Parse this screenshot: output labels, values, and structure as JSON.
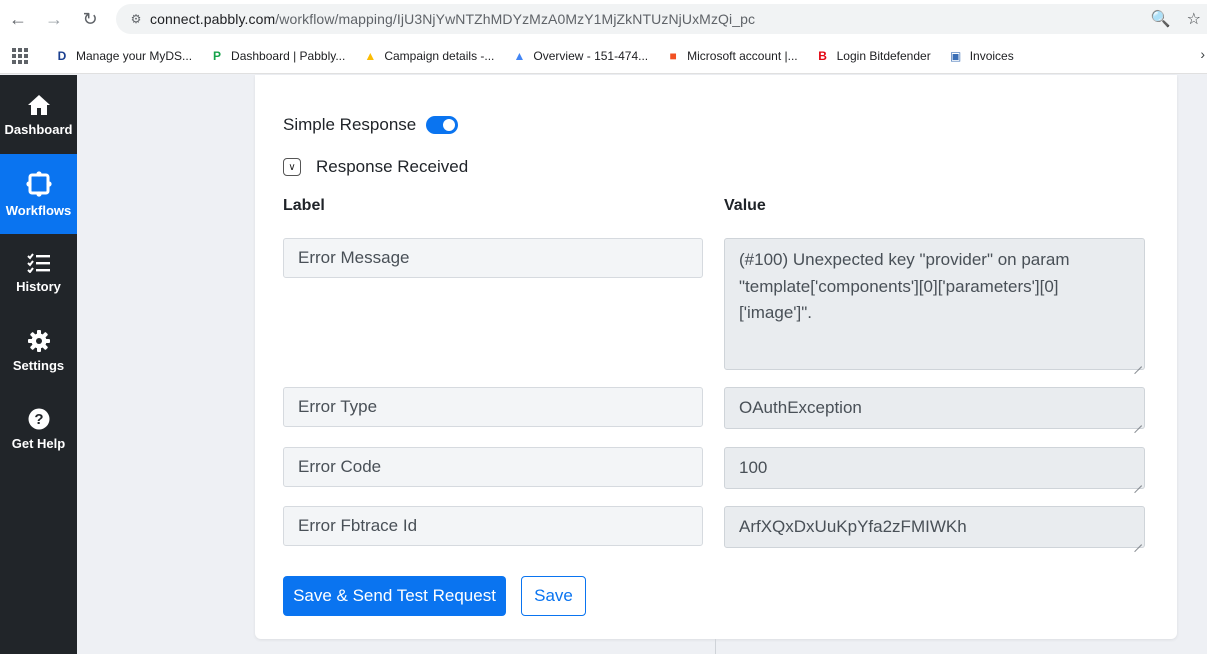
{
  "browser": {
    "url_host": "connect.pabbly.com",
    "url_path": "/workflow/mapping/IjU3NjYwNTZhMDYzMzA0MzY1MjZkNTUzNjUxMzQi_pc",
    "bookmarks": [
      {
        "label": "Manage your MyDS...",
        "icon": "D",
        "color": "#1a3f8f"
      },
      {
        "label": "Dashboard | Pabbly...",
        "icon": "P",
        "color": "#16a34a"
      },
      {
        "label": "Campaign details -...",
        "icon": "▲",
        "color": "#fbbc04"
      },
      {
        "label": "Overview - 151-474...",
        "icon": "▲",
        "color": "#4285f4"
      },
      {
        "label": "Microsoft account |...",
        "icon": "■",
        "color": "#f25022"
      },
      {
        "label": "Login Bitdefender",
        "icon": "B",
        "color": "#e30613"
      },
      {
        "label": "Invoices",
        "icon": "▣",
        "color": "#3b6fb6"
      }
    ]
  },
  "sidebar": {
    "items": [
      {
        "label": "Dashboard",
        "icon": "home-icon"
      },
      {
        "label": "Workflows",
        "icon": "workflow-icon",
        "active": true
      },
      {
        "label": "History",
        "icon": "list-check-icon"
      },
      {
        "label": "Settings",
        "icon": "gear-icon"
      },
      {
        "label": "Get Help",
        "icon": "help-icon"
      }
    ]
  },
  "form": {
    "simple_response_label": "Simple Response",
    "simple_response_on": true,
    "response_received_label": "Response Received",
    "label_header": "Label",
    "value_header": "Value",
    "rows": [
      {
        "label": "Error Message",
        "value": "(#100) Unexpected key \"provider\" on param \"template['components'][0]['parameters'][0]['image']\"."
      },
      {
        "label": "Error Type",
        "value": "OAuthException"
      },
      {
        "label": "Error Code",
        "value": "100"
      },
      {
        "label": "Error Fbtrace Id",
        "value": "ArfXQxDxUuKpYfa2zFMIWKh"
      }
    ],
    "send_button": "Save & Send Test Request",
    "save_button": "Save"
  }
}
